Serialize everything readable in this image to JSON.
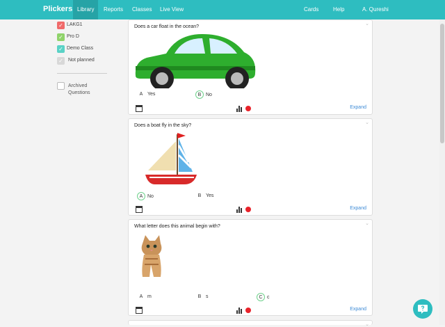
{
  "topbar": {
    "logo": "Plickers",
    "nav": [
      "Library",
      "Reports",
      "Classes",
      "Live View"
    ],
    "right": [
      "Cards",
      "Help",
      "A. Qureshi"
    ]
  },
  "sidebar": {
    "packs": [
      {
        "label": "LAKG1",
        "color": "#f06a6a",
        "checked": true
      },
      {
        "label": "Pro D",
        "color": "#8fd36a",
        "checked": true
      },
      {
        "label": "Demo Class",
        "color": "#5ad2c6",
        "checked": true
      },
      {
        "label": "Not planned",
        "color": "#d8d8d8",
        "checked": true
      }
    ],
    "archived_label": "Archived Questions"
  },
  "cards": [
    {
      "question": "Does a car float in the ocean?",
      "answers": [
        {
          "letter": "A",
          "text": "Yes",
          "correct": false
        },
        {
          "letter": "B",
          "text": "No",
          "correct": true
        }
      ],
      "expand": "Expand",
      "image": "green-car"
    },
    {
      "question": "Does a boat fly in the sky?",
      "answers": [
        {
          "letter": "A",
          "text": "No",
          "correct": true
        },
        {
          "letter": "B",
          "text": "Yes",
          "correct": false
        }
      ],
      "expand": "Expand",
      "image": "sailboat"
    },
    {
      "question": "What letter does this animal begin with?",
      "answers": [
        {
          "letter": "A",
          "text": "m",
          "correct": false
        },
        {
          "letter": "B",
          "text": "s",
          "correct": false
        },
        {
          "letter": "C",
          "text": "c",
          "correct": true
        }
      ],
      "expand": "Expand",
      "image": "kitten"
    }
  ],
  "colors": {
    "brand": "#2ebdc0",
    "status_dot": "#e8222a",
    "link": "#3e8bd6"
  }
}
